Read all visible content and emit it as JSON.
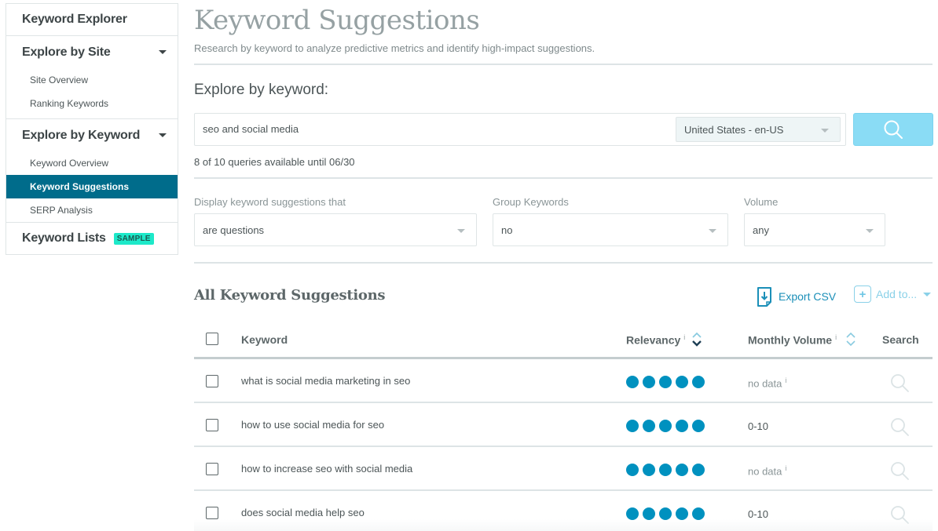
{
  "sidebar": {
    "header": "Keyword Explorer",
    "sections": [
      {
        "title": "Explore by Site",
        "items": [
          {
            "label": "Site Overview",
            "active": false
          },
          {
            "label": "Ranking Keywords",
            "active": false
          }
        ]
      },
      {
        "title": "Explore by Keyword",
        "items": [
          {
            "label": "Keyword Overview",
            "active": false
          },
          {
            "label": "Keyword Suggestions",
            "active": true
          },
          {
            "label": "SERP Analysis",
            "active": false
          }
        ]
      }
    ],
    "lists": {
      "label": "Keyword Lists",
      "badge": "SAMPLE"
    }
  },
  "header": {
    "title": "Keyword Suggestions",
    "subtitle": "Research by keyword to analyze predictive metrics and identify high-impact suggestions."
  },
  "explore": {
    "label": "Explore by keyword:",
    "query": "seo and social media",
    "locale": "United States - en-US",
    "search_icon": "search-icon",
    "queries_note": "8 of 10 queries available until 06/30"
  },
  "filters": {
    "display": {
      "label": "Display keyword suggestions that",
      "value": "are questions"
    },
    "group": {
      "label": "Group Keywords",
      "value": "no"
    },
    "volume": {
      "label": "Volume",
      "value": "any"
    }
  },
  "results": {
    "title": "All Keyword Suggestions",
    "export_label": "Export CSV",
    "add_label": "Add to...",
    "columns": {
      "keyword": "Keyword",
      "relevancy": "Relevancy",
      "volume": "Monthly Volume",
      "search": "Search",
      "info": "i"
    },
    "rows": [
      {
        "keyword": "what is social media marketing in seo",
        "relevancy": 5,
        "volume": "no data",
        "has_info": true
      },
      {
        "keyword": "how to use social media for seo",
        "relevancy": 5,
        "volume": "0-10",
        "has_info": false
      },
      {
        "keyword": "how to increase seo with social media",
        "relevancy": 5,
        "volume": "no data",
        "has_info": true
      },
      {
        "keyword": "does social media help seo",
        "relevancy": 5,
        "volume": "0-10",
        "has_info": false
      }
    ]
  },
  "colors": {
    "active_nav": "#006c8b",
    "badge": "#1de9c9",
    "search_button": "#8adcf5",
    "relevancy_dot": "#0091bf",
    "export_link": "#1b8fb8"
  }
}
